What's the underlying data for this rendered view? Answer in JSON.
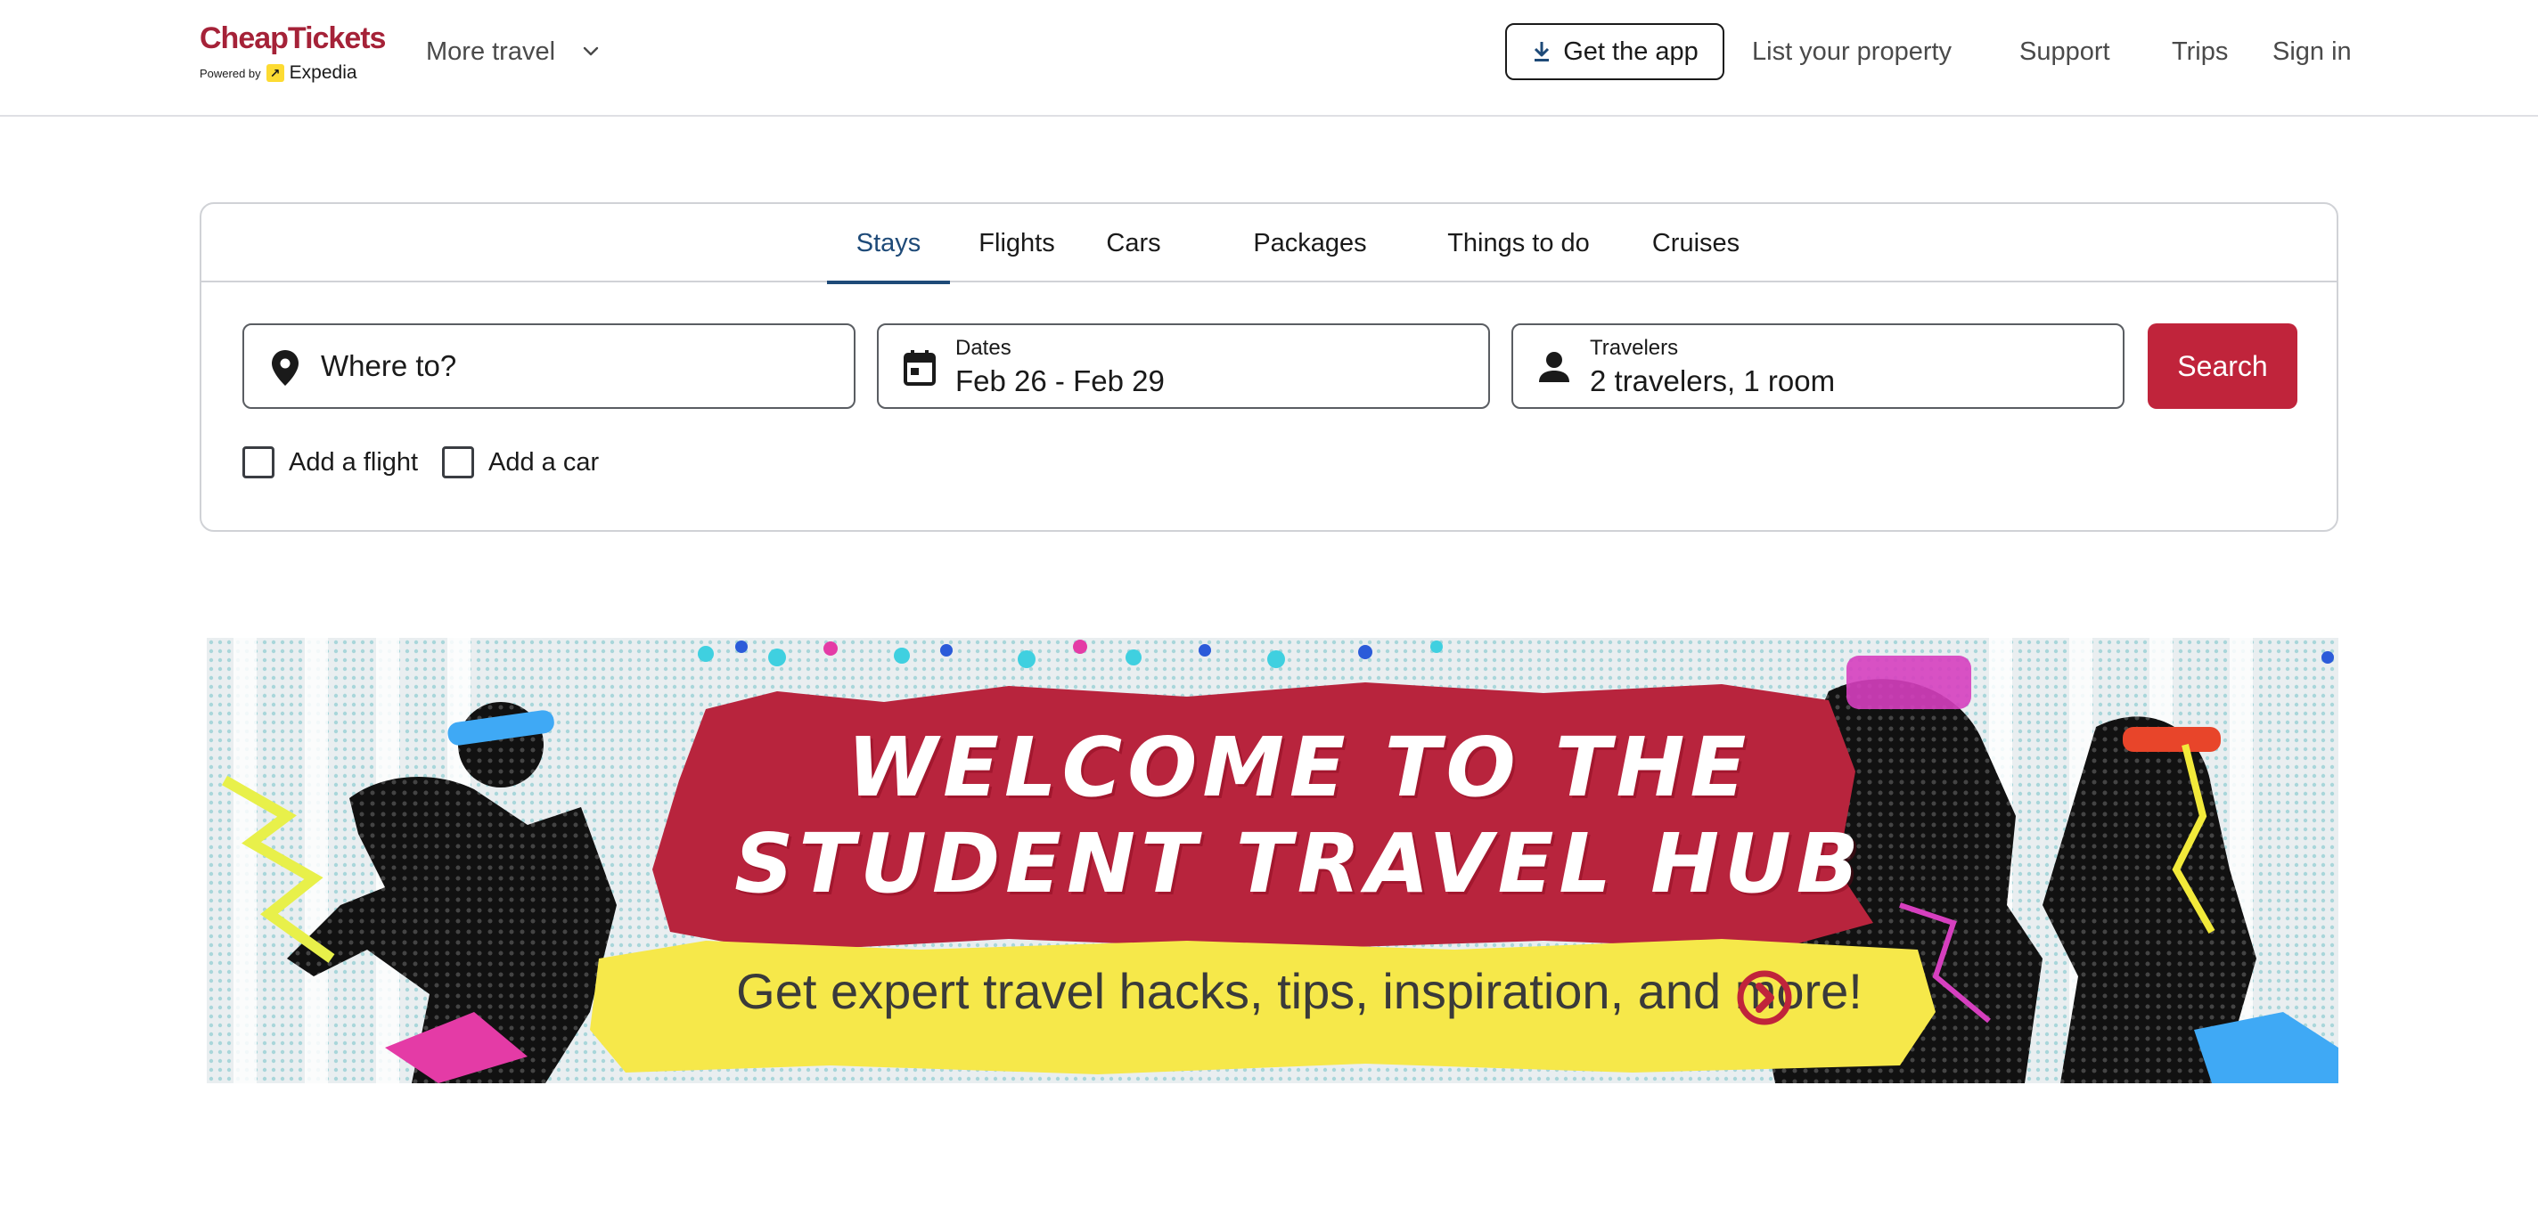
{
  "header": {
    "logo": {
      "name": "CheapTickets",
      "powered_by": "Powered by",
      "partner": "Expedia"
    },
    "more_travel": "More travel",
    "get_app": "Get the app",
    "nav": {
      "list_property": "List your property",
      "support": "Support",
      "trips": "Trips",
      "sign_in": "Sign in"
    }
  },
  "search": {
    "tabs": [
      {
        "label": "Stays",
        "active": true
      },
      {
        "label": "Flights",
        "active": false
      },
      {
        "label": "Cars",
        "active": false
      },
      {
        "label": "Packages",
        "active": false
      },
      {
        "label": "Things to do",
        "active": false
      },
      {
        "label": "Cruises",
        "active": false
      }
    ],
    "destination": {
      "placeholder": "Where to?",
      "icon": "map-pin-icon"
    },
    "dates": {
      "label": "Dates",
      "value": "Feb 26 - Feb 29",
      "icon": "calendar-icon"
    },
    "travelers": {
      "label": "Travelers",
      "value": "2 travelers, 1 room",
      "icon": "person-icon"
    },
    "search_button": "Search",
    "add_flight": {
      "label": "Add a flight",
      "checked": false
    },
    "add_car": {
      "label": "Add a car",
      "checked": false
    }
  },
  "banner": {
    "line1": "WELCOME TO THE",
    "line2": "STUDENT TRAVEL HUB",
    "subtitle": "Get expert travel hacks, tips, inspiration, and more!"
  },
  "colors": {
    "brand": "#c0243b",
    "active_tab": "#1e4a78",
    "banner_yellow": "#f6e84a",
    "banner_red": "#b8243d"
  }
}
